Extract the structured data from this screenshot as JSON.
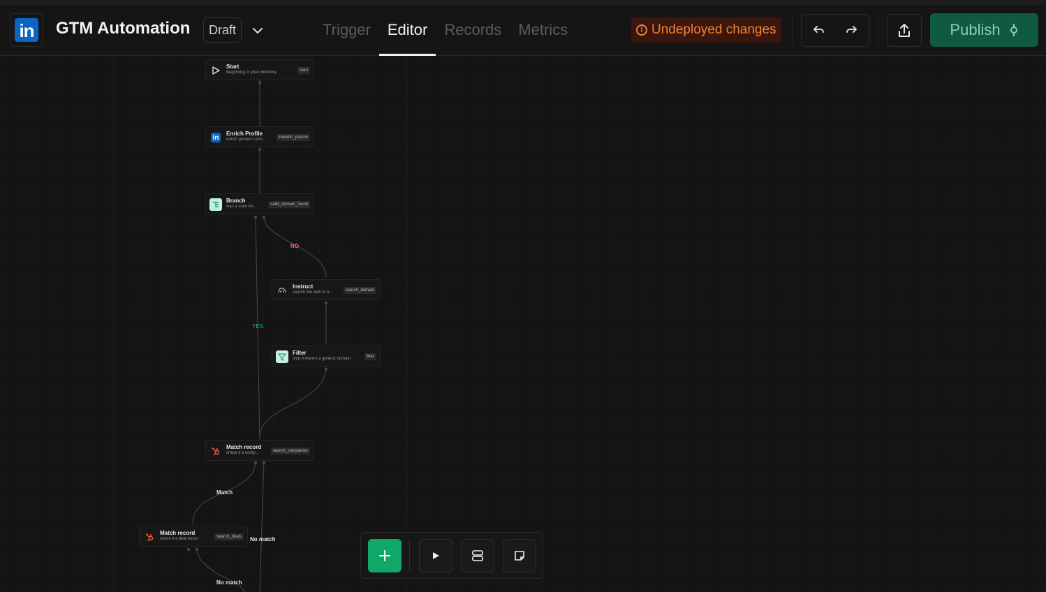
{
  "header": {
    "app_title": "GTM Automation",
    "logo_text": "in",
    "status": "Draft",
    "tabs": [
      {
        "label": "Trigger",
        "active": false
      },
      {
        "label": "Editor",
        "active": true
      },
      {
        "label": "Records",
        "active": false
      },
      {
        "label": "Metrics",
        "active": false
      }
    ],
    "undeployed_label": "Undeployed changes",
    "publish_label": "Publish",
    "colors": {
      "accent": "#0fa868",
      "warning": "#f5832f",
      "publish_bg": "#0f5a40",
      "linkedin": "#0a66c2",
      "hubspot": "#ff5c35"
    }
  },
  "workflow": {
    "nodes": [
      {
        "id": "start",
        "icon": "play-icon",
        "title": "Start",
        "subtitle": "Beginning of your workflow",
        "tag": "start"
      },
      {
        "id": "enrich",
        "icon": "linkedin-icon",
        "title": "Enrich Profile",
        "subtitle": "enrich person's pro...",
        "tag": "linkedin_person"
      },
      {
        "id": "branch",
        "icon": "branch-icon",
        "title": "Branch",
        "subtitle": "was a valid do...",
        "tag": "valid_domain_found"
      },
      {
        "id": "instruct",
        "icon": "ai-agent-icon",
        "title": "Instruct",
        "subtitle": "search the web to fi...",
        "tag": "search_domain"
      },
      {
        "id": "filter",
        "icon": "filter-icon",
        "title": "Filter",
        "subtitle": "stop if there's a generic domain",
        "tag": "filter"
      },
      {
        "id": "match_company",
        "icon": "hubspot-icon",
        "title": "Match record",
        "subtitle": "check if a comp...",
        "tag": "search_companies"
      },
      {
        "id": "match_deal",
        "icon": "hubspot-icon",
        "title": "Match record",
        "subtitle": "check if a deal exists",
        "tag": "search_deals"
      }
    ],
    "edge_labels": {
      "no": "NO",
      "yes": "YES",
      "match": "Match",
      "no_match_1": "No match",
      "no_match_2": "No match"
    }
  },
  "toolbox": {
    "tools": [
      {
        "name": "add-node-button",
        "icon": "plus-icon"
      },
      {
        "name": "run-button",
        "icon": "play-icon"
      },
      {
        "name": "layout-button",
        "icon": "stack-icon"
      },
      {
        "name": "note-button",
        "icon": "sticky-note-icon"
      }
    ]
  }
}
